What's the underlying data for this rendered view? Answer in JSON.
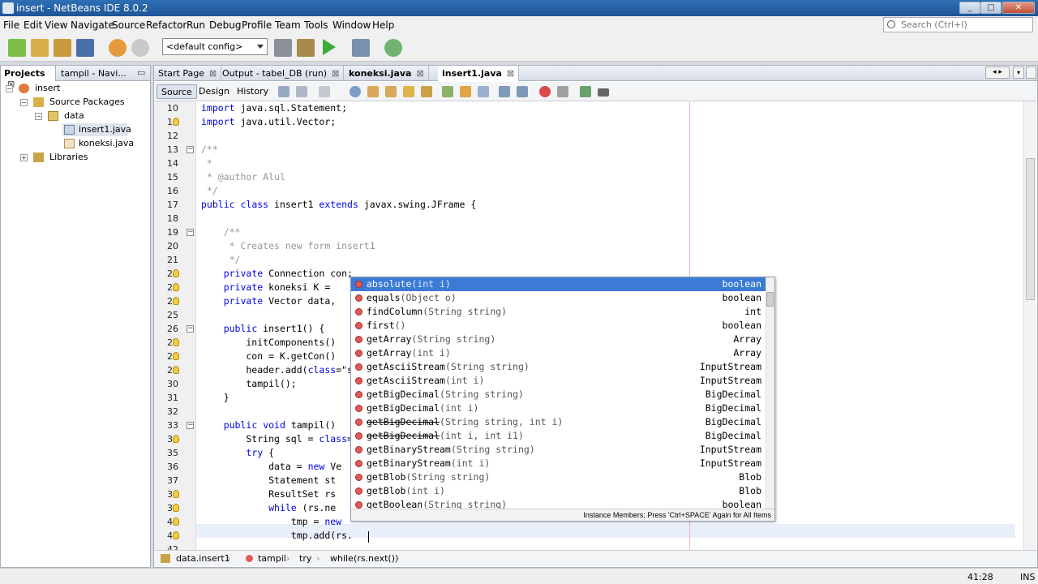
{
  "window": {
    "title": "insert - NetBeans IDE 8.0.2",
    "min": "_",
    "max": "□",
    "close": "✕"
  },
  "menu": [
    "File",
    "Edit",
    "View",
    "Navigate",
    "Source",
    "Refactor",
    "Run",
    "Debug",
    "Profile",
    "Team",
    "Tools",
    "Window",
    "Help"
  ],
  "search": {
    "placeholder": "Search (Ctrl+I)"
  },
  "toolbar": {
    "config": "<default config>"
  },
  "left_pane": {
    "tabs": [
      {
        "label": "Projects",
        "close": "⊠"
      },
      {
        "label": "tampil - Navi..."
      }
    ],
    "minimize": "▭",
    "tree": [
      "insert",
      "Source Packages",
      "data",
      "insert1.java",
      "koneksi.java",
      "Libraries"
    ]
  },
  "editor": {
    "tabs": [
      {
        "label": "Start Page",
        "close": "⊠"
      },
      {
        "label": "Output - tabel_DB (run)",
        "close": "⊠"
      },
      {
        "label": "koneksi.java",
        "close": "⊠"
      },
      {
        "label": "insert1.java",
        "close": "⊠"
      }
    ],
    "view_buttons": [
      "Source",
      "Design",
      "History"
    ],
    "line_numbers": [
      "10",
      "11",
      "12",
      "13",
      "14",
      "15",
      "16",
      "17",
      "18",
      "19",
      "20",
      "21",
      "22",
      "23",
      "24",
      "25",
      "26",
      "27",
      "28",
      "29",
      "30",
      "31",
      "32",
      "33",
      "34",
      "35",
      "36",
      "37",
      "38",
      "39",
      "40",
      "41",
      "42"
    ],
    "code": [
      "import java.sql.Statement;",
      "import java.util.Vector;",
      "",
      "/**",
      " *",
      " * @author Alul",
      " */",
      "public class insert1 extends javax.swing.JFrame {",
      "",
      "    /**",
      "     * Creates new form insert1",
      "     */",
      "    private Connection con;",
      "    private koneksi K = ",
      "    private Vector data,",
      "",
      "    public insert1() {",
      "        initComponents()",
      "        con = K.getCon()",
      "        header.add(\"NIM\"",
      "        tampil();",
      "    }",
      "",
      "    public void tampil()",
      "        String sql = \"SE",
      "        try {",
      "            data = new Ve",
      "            Statement st",
      "            ResultSet rs",
      "            while (rs.ne",
      "                tmp = new",
      "                tmp.add(rs.",
      ""
    ]
  },
  "completion": {
    "items": [
      {
        "name": "absolute",
        "params": "(int i)",
        "type": "boolean"
      },
      {
        "name": "equals",
        "params": "(Object o)",
        "type": "boolean"
      },
      {
        "name": "findColumn",
        "params": "(String string)",
        "type": "int"
      },
      {
        "name": "first",
        "params": "()",
        "type": "boolean"
      },
      {
        "name": "getArray",
        "params": "(String string)",
        "type": "Array"
      },
      {
        "name": "getArray",
        "params": "(int i)",
        "type": "Array"
      },
      {
        "name": "getAsciiStream",
        "params": "(String string)",
        "type": "InputStream"
      },
      {
        "name": "getAsciiStream",
        "params": "(int i)",
        "type": "InputStream"
      },
      {
        "name": "getBigDecimal",
        "params": "(String string)",
        "type": "BigDecimal"
      },
      {
        "name": "getBigDecimal",
        "params": "(int i)",
        "type": "BigDecimal"
      },
      {
        "name": "getBigDecimal",
        "params": "(String string, int i)",
        "type": "BigDecimal"
      },
      {
        "name": "getBigDecimal",
        "params": "(int i, int i1)",
        "type": "BigDecimal"
      },
      {
        "name": "getBinaryStream",
        "params": "(String string)",
        "type": "InputStream"
      },
      {
        "name": "getBinaryStream",
        "params": "(int i)",
        "type": "InputStream"
      },
      {
        "name": "getBlob",
        "params": "(String string)",
        "type": "Blob"
      },
      {
        "name": "getBlob",
        "params": "(int i)",
        "type": "Blob"
      },
      {
        "name": "getBoolean",
        "params": "(String string)",
        "type": "boolean"
      }
    ],
    "footer": "Instance Members; Press 'Ctrl+SPACE' Again for All Items"
  },
  "breadcrumb": [
    "data.insert1",
    "tampil",
    "try",
    "while",
    "(rs.next())"
  ],
  "status": {
    "position": "41:28",
    "mode": "INS"
  }
}
